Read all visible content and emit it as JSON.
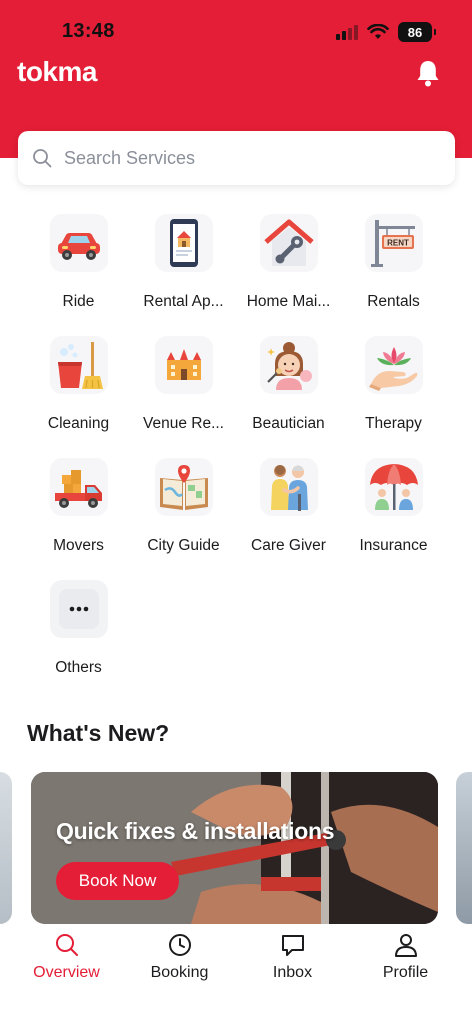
{
  "status_bar": {
    "time": "13:48",
    "battery": "86"
  },
  "header": {
    "brand": "tokma",
    "bell_icon": "bell-icon"
  },
  "search": {
    "placeholder": "Search Services",
    "value": ""
  },
  "services": [
    {
      "label": "Ride",
      "icon": "car-icon"
    },
    {
      "label": "Rental Ap...",
      "icon": "apartment-phone-icon"
    },
    {
      "label": "Home Mai...",
      "icon": "home-maintenance-icon"
    },
    {
      "label": "Rentals",
      "icon": "rent-sign-icon"
    },
    {
      "label": "Cleaning",
      "icon": "cleaning-icon"
    },
    {
      "label": "Venue Re...",
      "icon": "venue-icon"
    },
    {
      "label": "Beautician",
      "icon": "beautician-icon"
    },
    {
      "label": "Therapy",
      "icon": "therapy-icon"
    },
    {
      "label": "Movers",
      "icon": "truck-icon"
    },
    {
      "label": "City Guide",
      "icon": "map-guide-icon"
    },
    {
      "label": "Care Giver",
      "icon": "care-giver-icon"
    },
    {
      "label": "Insurance",
      "icon": "umbrella-icon"
    },
    {
      "label": "Others",
      "icon": "more-icon"
    }
  ],
  "whats_new": {
    "title": "What's New?",
    "banner": {
      "title": "Quick fixes & installations",
      "button": "Book Now"
    }
  },
  "tabs": [
    {
      "label": "Overview",
      "icon": "search-icon",
      "active": true
    },
    {
      "label": "Booking",
      "icon": "clock-icon",
      "active": false
    },
    {
      "label": "Inbox",
      "icon": "chat-icon",
      "active": false
    },
    {
      "label": "Profile",
      "icon": "user-icon",
      "active": false
    }
  ],
  "colors": {
    "brand": "#e31e36",
    "text": "#1c1c1e",
    "placeholder": "#8a8f99"
  }
}
